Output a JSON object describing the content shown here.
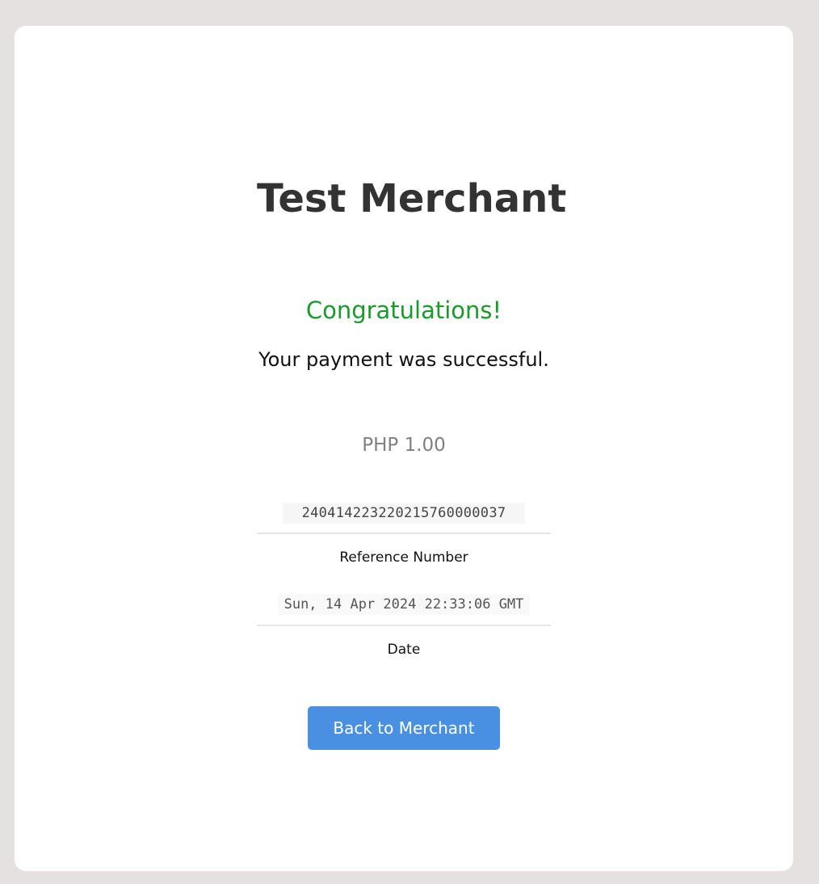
{
  "merchant": {
    "name": "Test Merchant"
  },
  "result": {
    "heading": "Congratulations!",
    "message": "Your payment was successful."
  },
  "payment": {
    "amount": "PHP 1.00",
    "reference_number": "240414223220215760000037",
    "reference_label": "Reference Number",
    "date": "Sun, 14 Apr 2024 22:33:06 GMT",
    "date_label": "Date"
  },
  "actions": {
    "back_label": "Back to Merchant"
  },
  "colors": {
    "success": "#1a9a2c",
    "button": "#4a90e2",
    "page_background": "#e5e1e0"
  }
}
